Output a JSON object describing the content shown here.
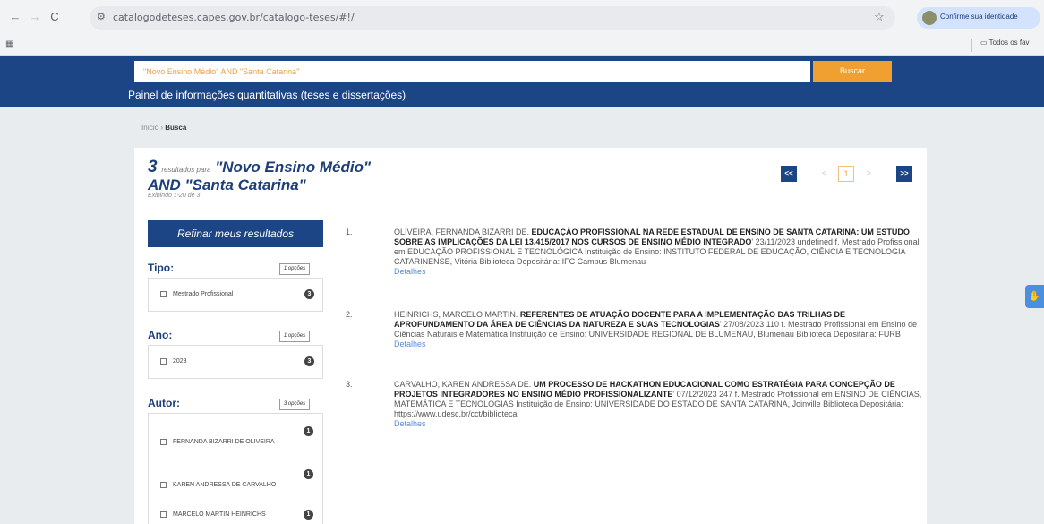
{
  "browser": {
    "url": "catalogodeteses.capes.gov.br/catalogo-teses/#!/",
    "profile_label": "Confirme sua identidade",
    "bookmarks_folder": "Todos os fav"
  },
  "header": {
    "search_value": "\"Novo Ensino Médio\" AND \"Santa Catarina\"",
    "search_button": "Buscar",
    "panel_link": "Painel de informações quantitativas (teses e dissertações)"
  },
  "breadcrumb": {
    "home": "Início",
    "sep": "›",
    "current": "Busca"
  },
  "results_header": {
    "count": "3",
    "results_for": "resultados para",
    "query": "\"Novo Ensino Médio\" AND \"Santa Catarina\"",
    "showing": "Exibindo 1-20 de 3"
  },
  "pagination": {
    "first": "<<",
    "prev": "<",
    "page": "1",
    "next": ">",
    "last": ">>"
  },
  "sidebar": {
    "refine_label": "Refinar meus resultados",
    "facets": [
      {
        "title": "Tipo:",
        "options_label": "1 opções",
        "items": [
          {
            "label": "Mestrado Profissional",
            "count": "3"
          }
        ]
      },
      {
        "title": "Ano:",
        "options_label": "1 opções",
        "items": [
          {
            "label": "2023",
            "count": "3"
          }
        ]
      },
      {
        "title": "Autor:",
        "options_label": "3 opções",
        "items": [
          {
            "label": "FERNANDA BIZARRI DE OLIVEIRA",
            "count": "1"
          },
          {
            "label": "KAREN ANDRESSA DE CARVALHO",
            "count": "1"
          },
          {
            "label": "MARCELO MARTIN HEINRICHS",
            "count": "1"
          }
        ]
      }
    ]
  },
  "results": [
    {
      "num": "1.",
      "author": "OLIVEIRA, FERNANDA BIZARRI DE.",
      "title": "EDUCAÇÃO PROFISSIONAL NA REDE ESTADUAL DE ENSINO DE SANTA CATARINA: UM ESTUDO SOBRE AS IMPLICAÇÕES DA LEI 13.415/2017 NOS CURSOS DE ENSINO MÉDIO INTEGRADO",
      "details": "' 23/11/2023 undefined f. Mestrado Profissional em EDUCAÇÃO PROFISSIONAL E TECNOLÓGICA Instituição de Ensino: INSTITUTO FEDERAL DE EDUCAÇÃO, CIÊNCIA E TECNOLOGIA CATARINENSE, Vitória Biblioteca Depositária: IFC Campus Blumenau",
      "link": "Detalhes"
    },
    {
      "num": "2.",
      "author": "HEINRICHS, MARCELO MARTIN.",
      "title": "REFERENTES DE ATUAÇÃO DOCENTE PARA A IMPLEMENTAÇÃO DAS TRILHAS DE APROFUNDAMENTO DA ÁREA DE CIÊNCIAS DA NATUREZA E SUAS TECNOLOGIAS",
      "details": "' 27/08/2023 110 f. Mestrado Profissional em Ensino de Ciências Naturais e Matemática Instituição de Ensino: UNIVERSIDADE REGIONAL DE BLUMENAU, Blumenau Biblioteca Depositária: FURB",
      "link": "Detalhes"
    },
    {
      "num": "3.",
      "author": "CARVALHO, KAREN ANDRESSA DE.",
      "title": "UM PROCESSO DE HACKATHON EDUCACIONAL COMO ESTRATÉGIA PARA CONCEPÇÃO DE PROJETOS INTEGRADORES NO ENSINO MÉDIO PROFISSIONALIZANTE",
      "details": "' 07/12/2023 247 f. Mestrado Profissional em ENSINO DE CIÊNCIAS, MATEMÁTICA E TECNOLOGIAS Instituição de Ensino: UNIVERSIDADE DO ESTADO DE SANTA CATARINA, Joinville Biblioteca Depositária: https://www.udesc.br/cct/biblioteca",
      "link": "Detalhes"
    }
  ]
}
